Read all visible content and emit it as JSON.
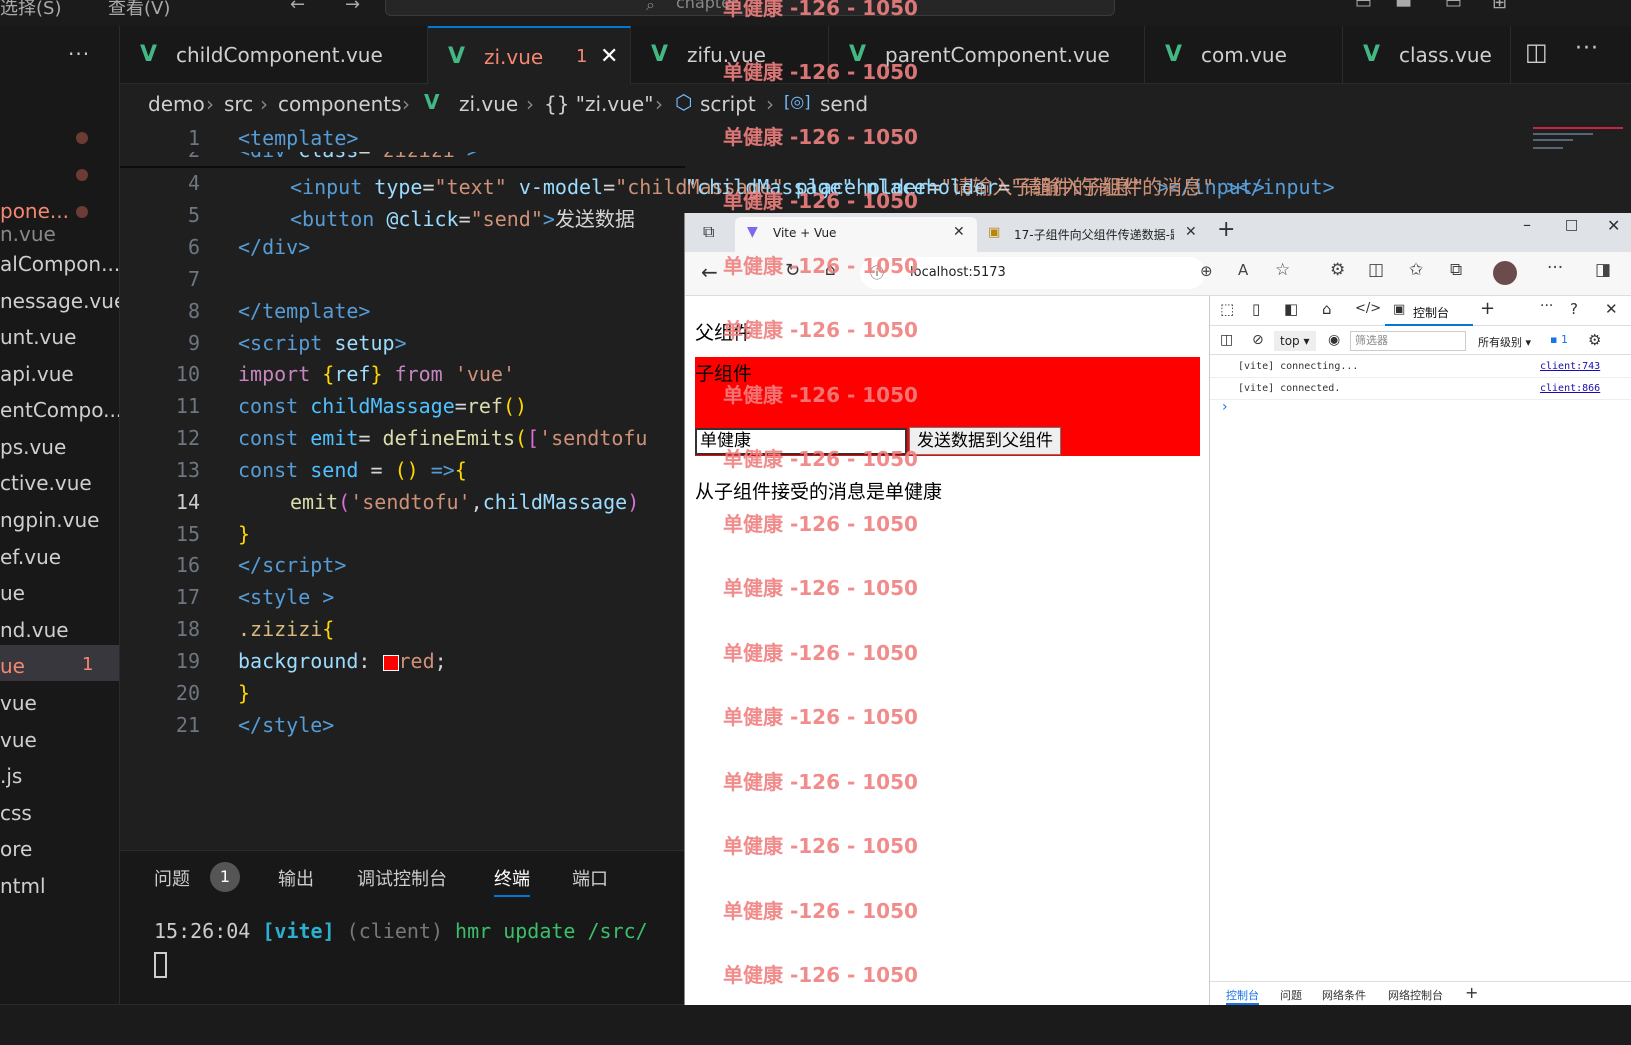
{
  "titlebar": {
    "menu_select": "选择(S)",
    "menu_view": "查看(V)",
    "search_text": "chapter"
  },
  "sidebar": {
    "files": [
      "pone...",
      "n.vue",
      "alCompon...",
      "nessage.vue",
      "unt.vue",
      "api.vue",
      "entCompo...",
      "ps.vue",
      "ctive.vue",
      "ngpin.vue",
      "ef.vue",
      "ue",
      "nd.vue",
      "ue",
      "vue",
      "vue",
      ".js",
      "css",
      "ore",
      "ntml"
    ],
    "active_badge": "1"
  },
  "tabs": [
    {
      "label": "childComponent.vue"
    },
    {
      "label": "zi.vue",
      "badge": "1"
    },
    {
      "label": "zifu.vue"
    },
    {
      "label": "parentComponent.vue"
    },
    {
      "label": "com.vue"
    },
    {
      "label": "class.vue"
    }
  ],
  "breadcrumb": [
    "demo",
    "src",
    "components",
    "zi.vue",
    "{} \"zi.vue\"",
    "script",
    "send"
  ],
  "code_lines": [
    "1",
    "2",
    "4",
    "5",
    "6",
    "7",
    "8",
    "9",
    "10",
    "11",
    "12",
    "13",
    "14",
    "15",
    "16",
    "17",
    "18",
    "19",
    "20",
    "21"
  ],
  "panel": {
    "tabs": [
      "问题",
      "输出",
      "调试控制台",
      "终端",
      "端口"
    ],
    "problem_count": "1",
    "terminal_time": "15:26:04",
    "terminal_vite": "[vite]",
    "terminal_client": "(client)",
    "terminal_msg": "hmr update /src/"
  },
  "browser": {
    "tab1": "Vite + Vue",
    "tab2": "17-子组件向父组件传递数据-题库",
    "url": "localhost:5173",
    "page": {
      "parent_label": "父组件",
      "child_label": "子组件",
      "input_value": "单健康",
      "send_button": "发送数据到父组件",
      "received": "从子组件接受的消息是单健康"
    },
    "devtools": {
      "console_tab": "控制台",
      "context": "top",
      "filter_placeholder": "筛选器",
      "level": "所有级别",
      "issues": "1",
      "logs": [
        {
          "text": "[vite] connecting...",
          "src": "client:743"
        },
        {
          "text": "[vite] connected.",
          "src": "client:866"
        }
      ],
      "bottom_tabs": [
        "控制台",
        "问题",
        "网络条件",
        "网络控制台"
      ]
    }
  },
  "watermark": "单健康 -126 - 1050",
  "colors": {
    "accent": "#42b883",
    "child_bg": "#ff0000",
    "error": "#f48771"
  }
}
